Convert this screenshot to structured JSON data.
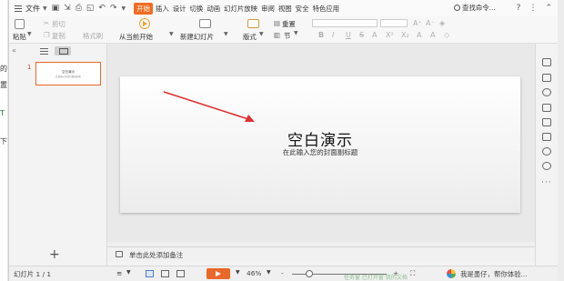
{
  "menubar": {
    "file_label": "文件",
    "tabs": [
      "开始",
      "插入",
      "设计",
      "切换",
      "动画",
      "幻灯片放映",
      "审阅",
      "视图",
      "安全",
      "特色应用"
    ],
    "active_tab": "开始",
    "search_label": "查找命令...",
    "icons": [
      "menu-icon",
      "save-icon",
      "print-icon",
      "undo-icon",
      "redo-icon",
      "search-icon",
      "help-icon",
      "more-icon",
      "collapse-ribbon-icon"
    ]
  },
  "ribbon": {
    "paste": "粘贴",
    "cut": "剪切",
    "copy": "复制",
    "format_painter": "格式刷",
    "from_current": "从当前开始",
    "new_slide": "新建幻灯片",
    "layout": "版式",
    "reset": "重置",
    "section": "节",
    "format_glyphs": [
      "B",
      "I",
      "U",
      "S",
      "A",
      "X²",
      "X₂",
      "A",
      "A",
      "◇"
    ]
  },
  "left_panel": {
    "slide_number": "1",
    "thumbnail_title": "空白演示",
    "thumbnail_subtitle": "在此输入您的封面副标题",
    "add_label": "+"
  },
  "slide": {
    "title": "空白演示",
    "subtitle": "在此输入您的封面副标题"
  },
  "notes": {
    "placeholder": "单击此处添加备注"
  },
  "status": {
    "slide_counter": "幻灯片 1 / 1",
    "zoom": "46%",
    "zoom_fraction": 0.18,
    "minus": "-",
    "plus": "+",
    "assistant": "我是墨仔，帮你体验..."
  },
  "background_window": {
    "edge_chars": [
      "的",
      "置",
      "T",
      "下"
    ],
    "peek_text": "任务窗    已打开窗    我的文档"
  },
  "colors": {
    "accent": "#f26b21",
    "arrow": "#e03030",
    "thumb_border": "#e8682a"
  }
}
